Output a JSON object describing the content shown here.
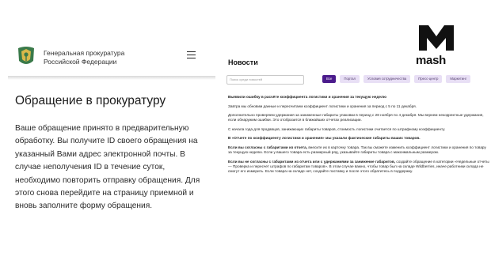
{
  "left": {
    "org_line1": "Генеральная прокуратура",
    "org_line2": "Российской Федерации",
    "page_title": "Обращение в прокуратуру",
    "notice": "Ваше обращение принято в предварительную обработку. Вы получите ID своего обращения на указанный Вами адрес электронной почты. В случае неполучения ID в течение суток, необходимо повторить отправку обращения. Для этого снова перейдите на страницу приемной и вновь заполните форму обращения."
  },
  "right": {
    "news_title": "Новости",
    "logo_word": "mash",
    "search_placeholder": "Поиск среди новостей",
    "chips": [
      "Все",
      "Портал",
      "Условия сотрудничества",
      "Пресс-центр",
      "Маркетинг"
    ],
    "article": {
      "p1": "Выявили ошибку в расчёте коэффициента логистики и хранения за текущую неделю",
      "p2": "Завтра мы обновим данные и пересчитаем коэффициент логистики и хранения за период с 5 по 11 декабря.",
      "p3": "Дополнительно проверяем удержания за заниженные габариты упаковки в период с 28 ноября по 4 декабря. Мы вернем некорректные удержания, если обнаружим ошибки. Это отобразится в ближайших отчетах реализации.",
      "p4": "С начала года для продавцов, занижающих габариты товаров, стоимость логистики считается по штрафному коэффициенту.",
      "p5": "В «Отчете по коэффициенту логистики и хранения» мы указали фактические габариты ваших товаров.",
      "p6_bold": "Если вы согласны с габаритами из отчета,",
      "p6_rest": " внесите их в карточку товара. Так вы сможете изменить коэффициент логистики и хранения по товару за текущую неделю. Если у вашего товара есть размерный ряд, указывайте габариты товара с максимальным размером.",
      "p7_bold": "Если вы не согласны с габаритами из отчета или с удержаниями за занижение габаритов,",
      "p7_rest": " создайте обращение в категории «Недельные отчеты — Проверка и пересчет штрафов по габаритам товаров». В этом случае важно, чтобы товар был на складе Wildberries, иначе работники склада не смогут его измерить. Если товара на складе нет, создайте поставку и после этого обратитесь в поддержку."
    }
  },
  "colors": {
    "accent": "#4b1b8c",
    "chip_bg": "#e8dff5",
    "emblem_green": "#3a7a4a"
  }
}
